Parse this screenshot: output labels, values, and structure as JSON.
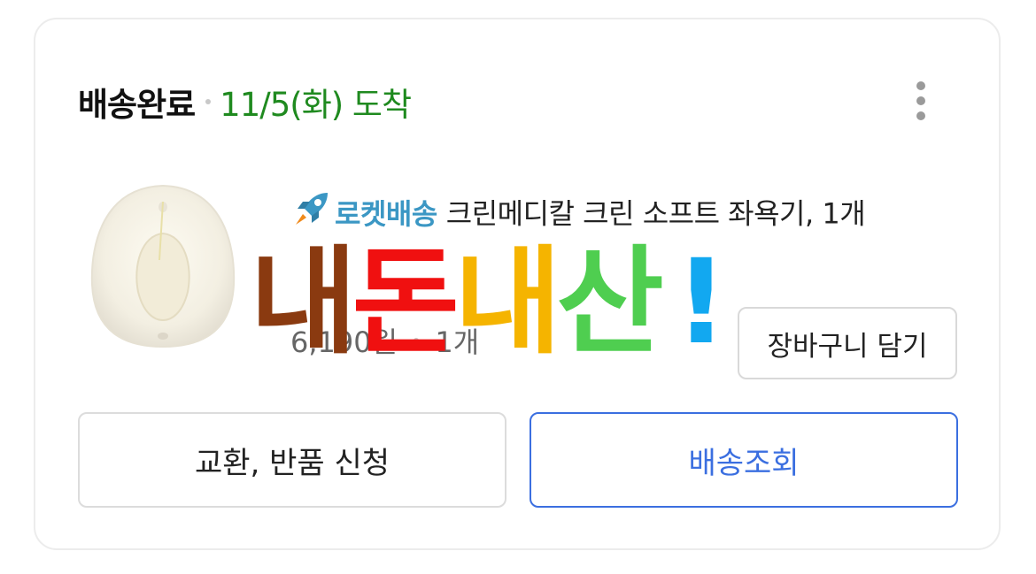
{
  "order": {
    "status": "배송완료",
    "arrival": "11/5(화) 도착"
  },
  "product": {
    "rocket_label": "로켓배송",
    "title": "크린메디칼 크린 소프트 좌욕기, 1개",
    "price": "6,190원",
    "quantity": "1개",
    "image_icon": "sitz-bath-product-image"
  },
  "actions": {
    "add_to_cart": "장바구니 담기",
    "exchange_return": "교환, 반품 신청",
    "track_delivery": "배송조회",
    "more_icon": "more-vertical-icon"
  },
  "watermark": {
    "chars": [
      "내",
      "돈",
      "내",
      "산",
      "!"
    ],
    "colors": [
      "#8a3a10",
      "#f01010",
      "#f5b400",
      "#4fce50",
      "#12a8f0"
    ]
  },
  "colors": {
    "status_date": "#1f8a1f",
    "rocket": "#3b97c4",
    "track_button": "#3b6fe0"
  }
}
